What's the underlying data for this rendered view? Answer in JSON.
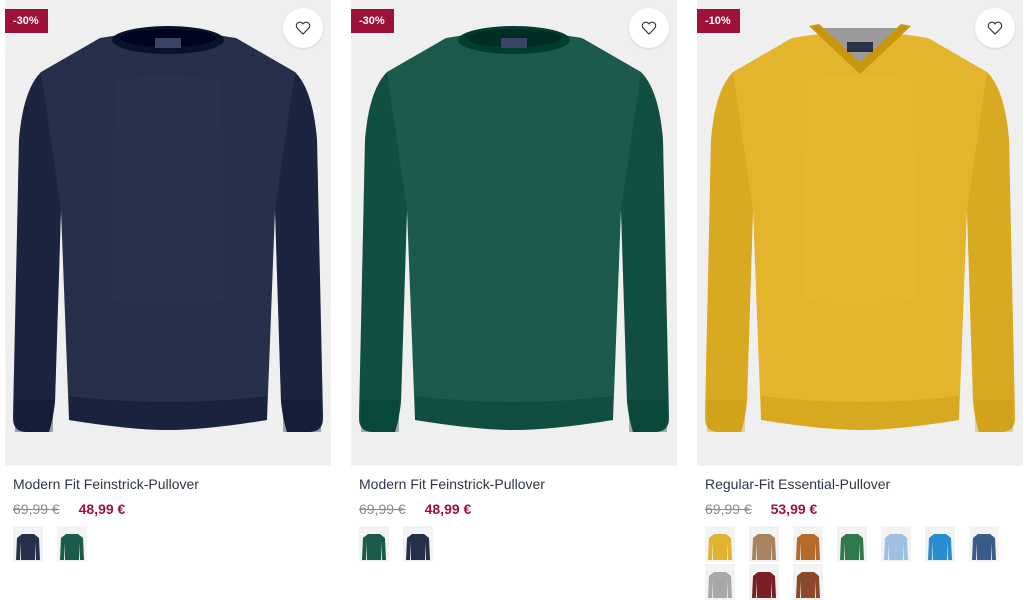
{
  "products": [
    {
      "badge": "-30%",
      "title": "Modern Fit Feinstrick-Pullover",
      "old_price": "69,99 €",
      "new_price": "48,99 €",
      "image": "crew-neck-sweater",
      "color": "#26304a",
      "swatches": [
        {
          "color": "#26304a",
          "name": "navy"
        },
        {
          "color": "#1c5a4c",
          "name": "green"
        }
      ]
    },
    {
      "badge": "-30%",
      "title": "Modern Fit Feinstrick-Pullover",
      "old_price": "69,99 €",
      "new_price": "48,99 €",
      "image": "crew-neck-sweater",
      "color": "#1d5a4e",
      "swatches": [
        {
          "color": "#1c5a4c",
          "name": "green"
        },
        {
          "color": "#26304a",
          "name": "navy"
        }
      ]
    },
    {
      "badge": "-10%",
      "title": "Regular-Fit Essential-Pullover",
      "old_price": "69,99 €",
      "new_price": "53,99 €",
      "image": "v-neck-sweater",
      "color": "#e4b42c",
      "swatches": [
        {
          "color": "#e0b330",
          "name": "yellow"
        },
        {
          "color": "#a88260",
          "name": "taupe"
        },
        {
          "color": "#b56a2a",
          "name": "cognac"
        },
        {
          "color": "#2f7a4a",
          "name": "green"
        },
        {
          "color": "#9cc0e0",
          "name": "light-blue"
        },
        {
          "color": "#2a8cd0",
          "name": "blue"
        },
        {
          "color": "#3a5a8a",
          "name": "denim"
        },
        {
          "color": "#a8a8a8",
          "name": "grey"
        },
        {
          "color": "#7a1f25",
          "name": "bordeaux"
        },
        {
          "color": "#8a4a2a",
          "name": "brown"
        }
      ]
    }
  ],
  "icons": {
    "favorite": "heart-outline-icon"
  }
}
